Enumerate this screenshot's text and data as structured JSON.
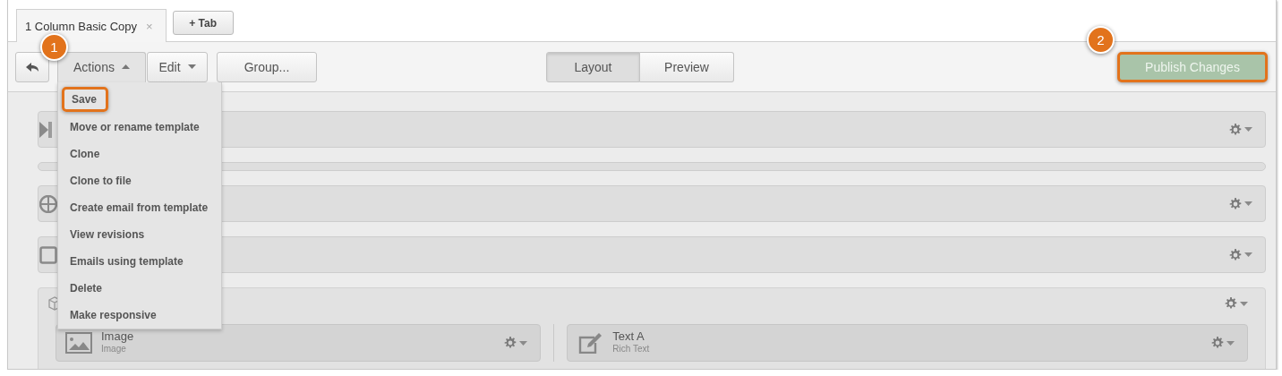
{
  "tabs": [
    {
      "label": "1 Column Basic Copy",
      "close": "×",
      "selected": true
    }
  ],
  "add_tab_button": "+ Tab",
  "toolbar": {
    "buttons": [
      {
        "label": "Actions",
        "kind": "dropdown",
        "expanded": true
      },
      {
        "label": "Edit",
        "kind": "dropdown",
        "expanded": false
      },
      {
        "label": "Group...",
        "kind": "plain"
      }
    ],
    "view_toggle": [
      {
        "label": "Layout",
        "selected": true
      },
      {
        "label": "Preview",
        "selected": false
      }
    ],
    "publish_button": "Publish Changes"
  },
  "actions_menu": [
    {
      "label": "Save",
      "highlighted": true
    },
    {
      "label": "Move or rename template",
      "highlighted": false
    },
    {
      "label": "Clone",
      "highlighted": false
    },
    {
      "label": "Clone to file",
      "highlighted": false
    },
    {
      "label": "Create email from template",
      "highlighted": false
    },
    {
      "label": "View revisions",
      "highlighted": false
    },
    {
      "label": "Emails using template",
      "highlighted": false
    },
    {
      "label": "Delete",
      "highlighted": false
    },
    {
      "label": "Make responsive",
      "highlighted": false
    }
  ],
  "callouts": [
    {
      "number": "1"
    },
    {
      "number": "2"
    }
  ],
  "modules": [
    {
      "kind": "module"
    },
    {
      "kind": "bar"
    },
    {
      "kind": "module"
    },
    {
      "kind": "module"
    },
    {
      "kind": "container",
      "children": [
        {
          "title": "Image",
          "subtitle": "Image"
        },
        {
          "title": "Text A",
          "subtitle": "Rich Text"
        }
      ]
    }
  ]
}
